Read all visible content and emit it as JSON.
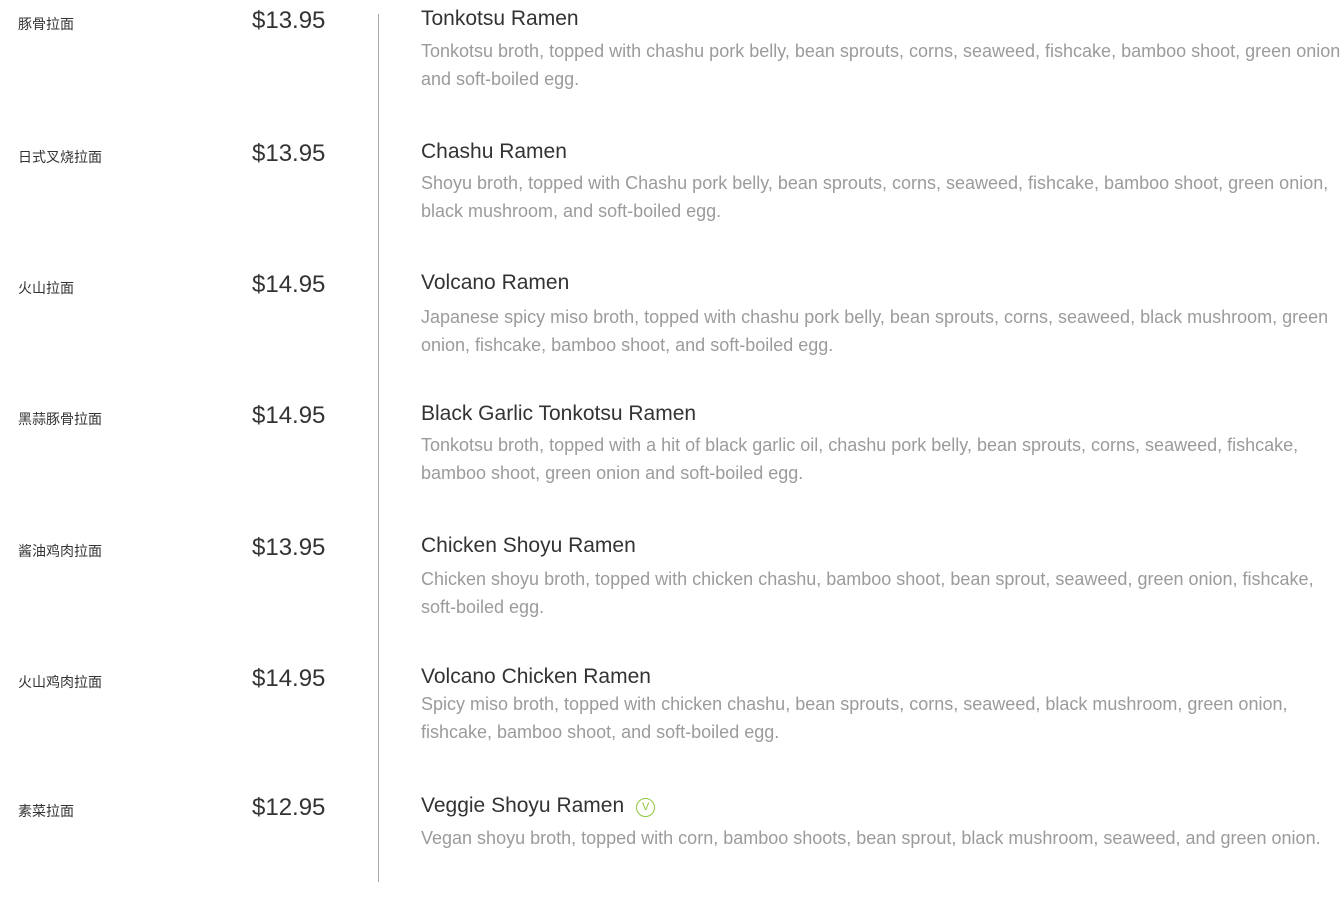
{
  "menu": {
    "items": [
      {
        "cn_name": "豚骨拉面",
        "price": "$13.95",
        "name": "Tonkotsu Ramen",
        "description": "Tonkotsu broth, topped with chashu pork belly, bean sprouts, corns, seaweed, fishcake, bamboo shoot, green onion and soft-boiled egg."
      },
      {
        "cn_name": "日式叉烧拉面",
        "price": "$13.95",
        "name": "Chashu Ramen",
        "description": "Shoyu broth, topped with Chashu pork belly, bean sprouts, corns, seaweed, fishcake, bamboo shoot, green onion, black mushroom, and soft-boiled egg."
      },
      {
        "cn_name": "火山拉面",
        "price": "$14.95",
        "name": "Volcano Ramen",
        "description": "Japanese spicy miso broth, topped with chashu pork belly, bean sprouts, corns, seaweed, black mushroom, green onion, fishcake, bamboo shoot, and soft-boiled egg."
      },
      {
        "cn_name": "黑蒜豚骨拉面",
        "price": "$14.95",
        "name": "Black Garlic Tonkotsu Ramen",
        "description": "Tonkotsu broth, topped with a hit of black garlic oil, chashu pork belly, bean sprouts, corns, seaweed, fishcake, bamboo shoot, green onion and soft-boiled egg."
      },
      {
        "cn_name": "酱油鸡肉拉面",
        "price": "$13.95",
        "name": "Chicken Shoyu Ramen",
        "description": "Chicken shoyu broth, topped with chicken chashu, bamboo shoot, bean sprout, seaweed, green onion, fishcake, soft-boiled egg."
      },
      {
        "cn_name": "火山鸡肉拉面",
        "price": "$14.95",
        "name": "Volcano Chicken Ramen",
        "description": "Spicy miso broth, topped with chicken chashu, bean sprouts, corns, seaweed, black mushroom, green onion, fishcake, bamboo shoot, and soft-boiled egg."
      },
      {
        "cn_name": "素菜拉面",
        "price": "$12.95",
        "name": "Veggie Shoyu Ramen",
        "veg_badge": "V",
        "description": "Vegan shoyu broth, topped with corn, bamboo shoots, bean sprout, black mushroom, seaweed, and green onion."
      }
    ]
  },
  "colors": {
    "text_primary": "#333333",
    "text_description": "#9b9b9b",
    "divider": "#a8a8a8",
    "vegan_badge": "#8dc63f"
  },
  "icons": {
    "vegan_badge": "circled-v-icon"
  }
}
